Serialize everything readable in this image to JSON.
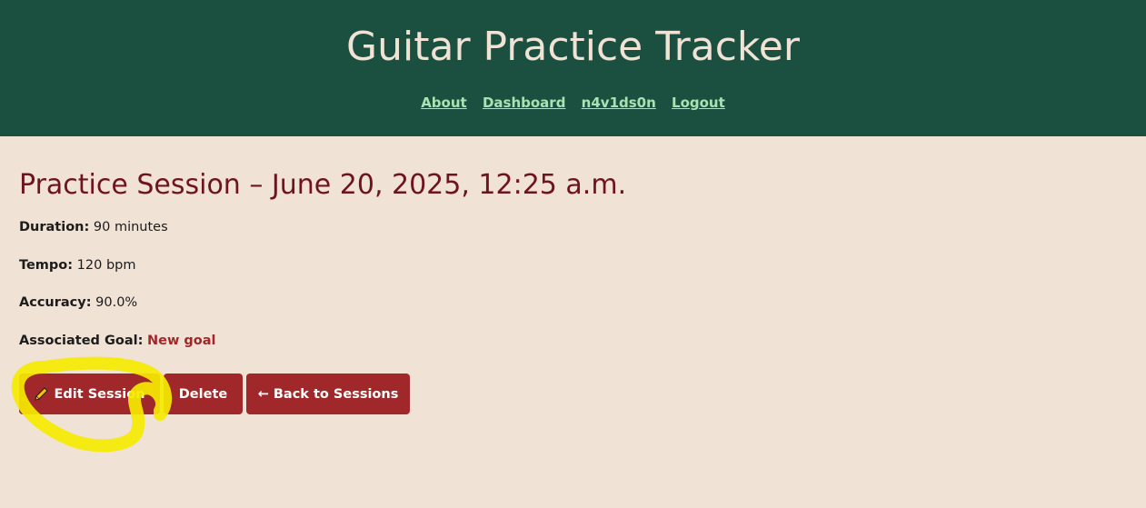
{
  "header": {
    "title": "Guitar Practice Tracker",
    "nav": [
      "About",
      "Dashboard",
      "n4v1ds0n",
      "Logout"
    ]
  },
  "session": {
    "heading": "Practice Session – June 20, 2025, 12:25 a.m.",
    "duration_label": "Duration:",
    "duration_value": "90 minutes",
    "tempo_label": "Tempo:",
    "tempo_value": "120 bpm",
    "accuracy_label": "Accuracy:",
    "accuracy_value": "90.0%",
    "goal_label": "Associated Goal:",
    "goal_value": "New goal"
  },
  "actions": {
    "edit_label": "Edit Session",
    "delete_label": "Delete",
    "back_label": "← Back to Sessions"
  },
  "colors": {
    "header_bg": "#1b4f40",
    "page_bg": "#f0e2d5",
    "accent": "#a0282b",
    "heading": "#6e1421",
    "nav_link": "#a8e4b2",
    "highlight": "#f5ea00"
  },
  "icons": {
    "edit": "pencil-icon"
  }
}
